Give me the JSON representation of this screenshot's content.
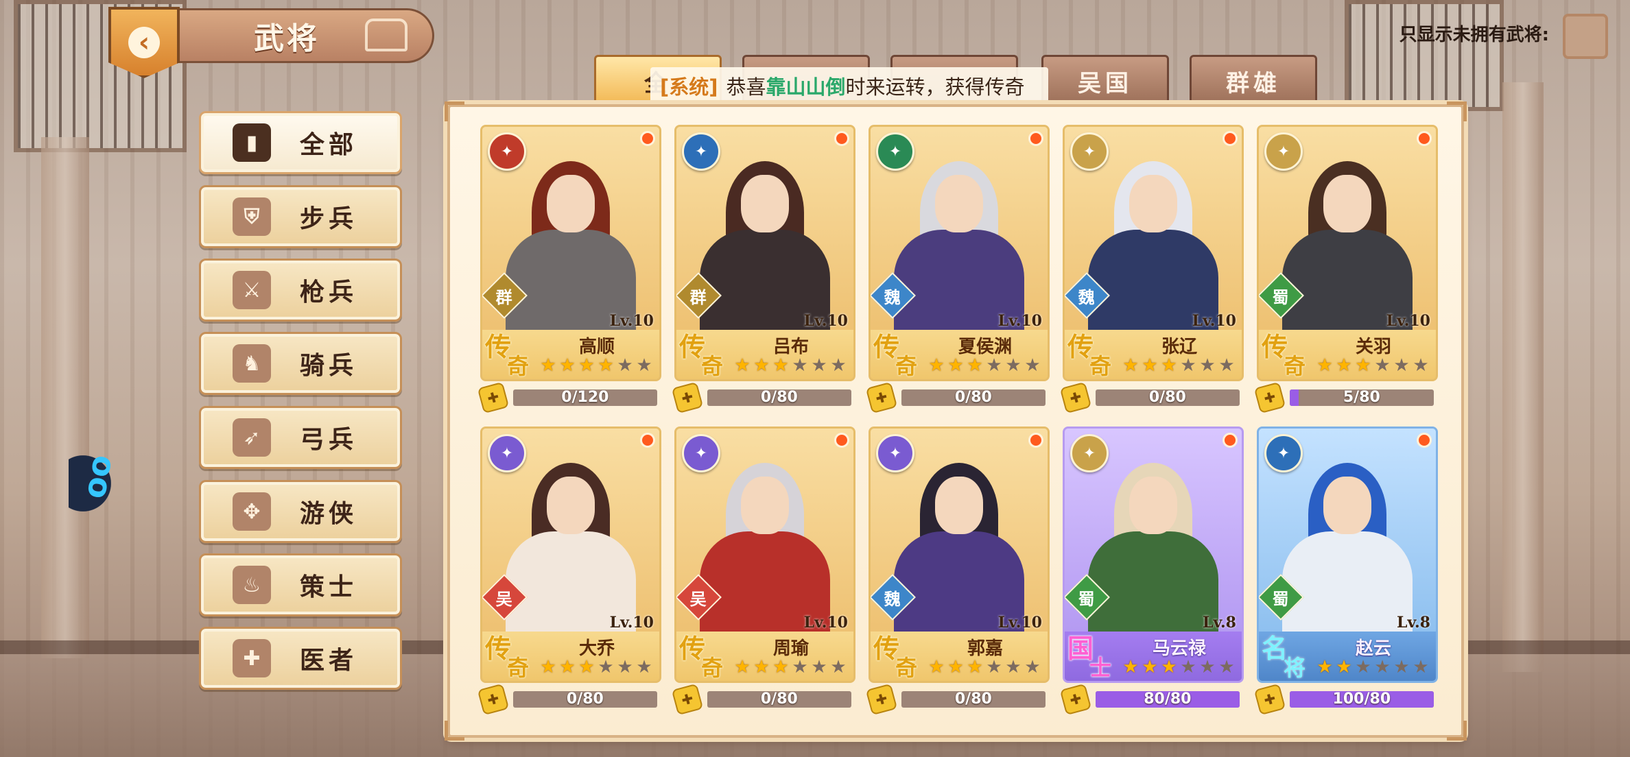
{
  "header": {
    "title": "武将",
    "back_icon": "back-arrow-icon",
    "filter_label": "只显示未拥有武将:"
  },
  "sidebar": {
    "items": [
      {
        "label": "全部",
        "icon": "card-icon",
        "glyph": "▮",
        "active": true
      },
      {
        "label": "步兵",
        "icon": "infantry-shield-icon",
        "glyph": "⛨",
        "active": false
      },
      {
        "label": "枪兵",
        "icon": "spear-icon",
        "glyph": "⚔",
        "active": false
      },
      {
        "label": "骑兵",
        "icon": "horse-icon",
        "glyph": "♞",
        "active": false
      },
      {
        "label": "弓兵",
        "icon": "bow-icon",
        "glyph": "➶",
        "active": false
      },
      {
        "label": "游侠",
        "icon": "ranger-icon",
        "glyph": "✥",
        "active": false
      },
      {
        "label": "策士",
        "icon": "strategist-flame-icon",
        "glyph": "♨",
        "active": false
      },
      {
        "label": "医者",
        "icon": "healer-icon",
        "glyph": "✚",
        "active": false
      }
    ]
  },
  "tabs": [
    {
      "label": "全",
      "active": true
    },
    {
      "label": "",
      "active": false
    },
    {
      "label": "",
      "active": false
    },
    {
      "label": "吴国",
      "active": false
    },
    {
      "label": "群雄",
      "active": false
    }
  ],
  "broadcast": {
    "tag": "[系统]",
    "prefix": "恭喜 ",
    "player": "靠山山倒",
    "message": " 时来运转，获得传奇"
  },
  "generals": [
    {
      "name": "高顺",
      "level": "Lv.10",
      "kingdom": "群",
      "kingdom_color": "#b08a2e",
      "rarity": [
        "传",
        "奇"
      ],
      "rarity_style": "gold",
      "stars": 4,
      "max_stars": 6,
      "fragments": "0/120",
      "progress": 0,
      "card_style": "gold",
      "unit_icon": "infantry-shield-icon",
      "unit_color": "#c03b2a",
      "hair": "#7d2a1a",
      "body": "#6f6a6a"
    },
    {
      "name": "吕布",
      "level": "Lv.10",
      "kingdom": "群",
      "kingdom_color": "#b08a2e",
      "rarity": [
        "传",
        "奇"
      ],
      "rarity_style": "gold",
      "stars": 3,
      "max_stars": 6,
      "fragments": "0/80",
      "progress": 0,
      "card_style": "gold",
      "unit_icon": "spear-icon",
      "unit_color": "#2d6fb8",
      "hair": "#4a2a22",
      "body": "#3a2f30"
    },
    {
      "name": "夏侯渊",
      "level": "Lv.10",
      "kingdom": "魏",
      "kingdom_color": "#3d86c9",
      "rarity": [
        "传",
        "奇"
      ],
      "rarity_style": "gold",
      "stars": 3,
      "max_stars": 6,
      "fragments": "0/80",
      "progress": 0,
      "card_style": "gold",
      "unit_icon": "bow-icon",
      "unit_color": "#2a8a55",
      "hair": "#d9d9de",
      "body": "#4b3d7e"
    },
    {
      "name": "张辽",
      "level": "Lv.10",
      "kingdom": "魏",
      "kingdom_color": "#3d86c9",
      "rarity": [
        "传",
        "奇"
      ],
      "rarity_style": "gold",
      "stars": 3,
      "max_stars": 6,
      "fragments": "0/80",
      "progress": 0,
      "card_style": "gold",
      "unit_icon": "horse-icon",
      "unit_color": "#c9a24a",
      "hair": "#e4e6ee",
      "body": "#2f3a66"
    },
    {
      "name": "关羽",
      "level": "Lv.10",
      "kingdom": "蜀",
      "kingdom_color": "#3f9b45",
      "rarity": [
        "传",
        "奇"
      ],
      "rarity_style": "gold",
      "stars": 3,
      "max_stars": 6,
      "fragments": "5/80",
      "progress": 0.0625,
      "card_style": "gold",
      "unit_icon": "horse-icon",
      "unit_color": "#c9a24a",
      "hair": "#4a2f22",
      "body": "#3e3e44"
    },
    {
      "name": "大乔",
      "level": "Lv.10",
      "kingdom": "吴",
      "kingdom_color": "#d6473b",
      "rarity": [
        "传",
        "奇"
      ],
      "rarity_style": "gold",
      "stars": 3,
      "max_stars": 6,
      "fragments": "0/80",
      "progress": 0,
      "card_style": "gold",
      "unit_icon": "strategist-flame-icon",
      "unit_color": "#7a5bd1",
      "hair": "#4a2c24",
      "body": "#f2e7dc"
    },
    {
      "name": "周瑜",
      "level": "Lv.10",
      "kingdom": "吴",
      "kingdom_color": "#d6473b",
      "rarity": [
        "传",
        "奇"
      ],
      "rarity_style": "gold",
      "stars": 3,
      "max_stars": 6,
      "fragments": "0/80",
      "progress": 0,
      "card_style": "gold",
      "unit_icon": "strategist-flame-icon",
      "unit_color": "#7a5bd1",
      "hair": "#d6d3d8",
      "body": "#b8302a"
    },
    {
      "name": "郭嘉",
      "level": "Lv.10",
      "kingdom": "魏",
      "kingdom_color": "#3d86c9",
      "rarity": [
        "传",
        "奇"
      ],
      "rarity_style": "gold",
      "stars": 3,
      "max_stars": 6,
      "fragments": "0/80",
      "progress": 0,
      "card_style": "gold",
      "unit_icon": "strategist-flame-icon",
      "unit_color": "#7a5bd1",
      "hair": "#2a2433",
      "body": "#4d3a84"
    },
    {
      "name": "马云禄",
      "level": "Lv.8",
      "kingdom": "蜀",
      "kingdom_color": "#3f9b45",
      "rarity": [
        "国",
        "士"
      ],
      "rarity_style": "pink",
      "stars": 3,
      "max_stars": 6,
      "fragments": "80/80",
      "progress": 1,
      "card_style": "purple",
      "unit_icon": "horse-icon",
      "unit_color": "#c9a24a",
      "hair": "#e6d6b8",
      "body": "#3f6e3a"
    },
    {
      "name": "赵云",
      "level": "Lv.8",
      "kingdom": "蜀",
      "kingdom_color": "#3f9b45",
      "rarity": [
        "名",
        "将"
      ],
      "rarity_style": "cyan",
      "stars": 2,
      "max_stars": 6,
      "fragments": "100/80",
      "progress": 1,
      "card_style": "blue",
      "unit_icon": "spear-icon",
      "unit_color": "#2d6fb8",
      "hair": "#2a5fc4",
      "body": "#e9eef5"
    }
  ]
}
